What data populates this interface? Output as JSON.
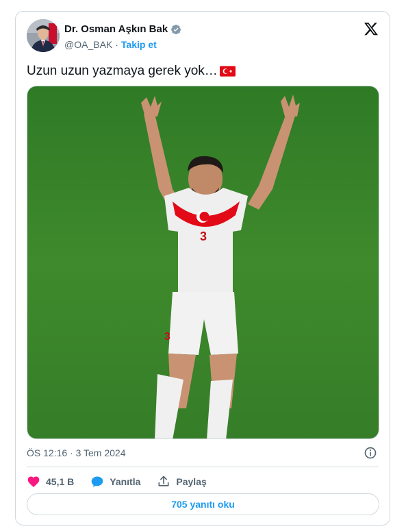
{
  "author": {
    "display_name": "Dr. Osman Aşkın Bak",
    "handle": "@OA_BAK",
    "separator": "·",
    "follow_label": "Takip et"
  },
  "tweet": {
    "text": "Uzun uzun yazmaya gerek yok…",
    "timestamp": "ÖS 12:16 · 3 Tem 2024"
  },
  "actions": {
    "like_count": "45,1 B",
    "reply_label": "Yanıtla",
    "share_label": "Paylaş"
  },
  "replies_button": "705 yanıtı oku",
  "colors": {
    "accent": "#1d9bf0",
    "like": "#f91880",
    "flag_red": "#e30a17",
    "pitch_green": "#3f8a2c"
  },
  "icons": [
    "verified-badge-icon",
    "x-logo-icon",
    "turkish-flag-icon",
    "info-icon",
    "heart-icon",
    "reply-bubble-icon",
    "share-icon"
  ]
}
